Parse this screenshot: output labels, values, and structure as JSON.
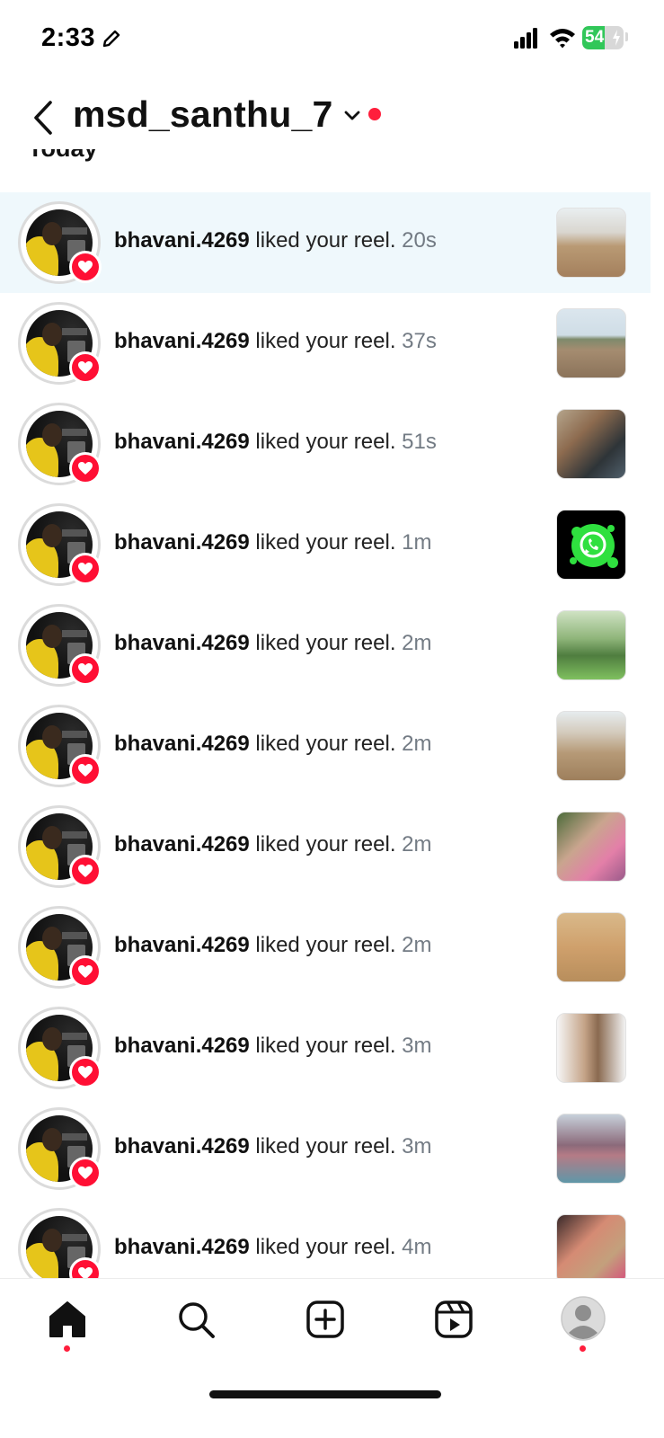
{
  "status_bar": {
    "time": "2:33",
    "battery_percent": "54",
    "battery_level": 0.54
  },
  "header": {
    "account_name": "msd_santhu_7"
  },
  "section": {
    "heading": "Today"
  },
  "notifications": [
    {
      "username": "bhavani.4269",
      "action": " liked your reel. ",
      "time": "20s"
    },
    {
      "username": "bhavani.4269",
      "action": " liked your reel. ",
      "time": "37s"
    },
    {
      "username": "bhavani.4269",
      "action": " liked your reel. ",
      "time": "51s"
    },
    {
      "username": "bhavani.4269",
      "action": " liked your reel. ",
      "time": "1m"
    },
    {
      "username": "bhavani.4269",
      "action": " liked your reel. ",
      "time": "2m"
    },
    {
      "username": "bhavani.4269",
      "action": " liked your reel. ",
      "time": "2m"
    },
    {
      "username": "bhavani.4269",
      "action": " liked your reel. ",
      "time": "2m"
    },
    {
      "username": "bhavani.4269",
      "action": " liked your reel. ",
      "time": "2m"
    },
    {
      "username": "bhavani.4269",
      "action": " liked your reel. ",
      "time": "3m"
    },
    {
      "username": "bhavani.4269",
      "action": " liked your reel. ",
      "time": "3m"
    },
    {
      "username": "bhavani.4269",
      "action": " liked your reel. ",
      "time": "4m"
    }
  ],
  "bottom_nav": {
    "items": [
      "home-icon",
      "search-icon",
      "create-icon",
      "reels-icon",
      "profile-icon"
    ]
  },
  "colors": {
    "accent_red": "#ff1e3c",
    "highlight_row": "#eff8fc",
    "timestamp_gray": "#737b84"
  }
}
